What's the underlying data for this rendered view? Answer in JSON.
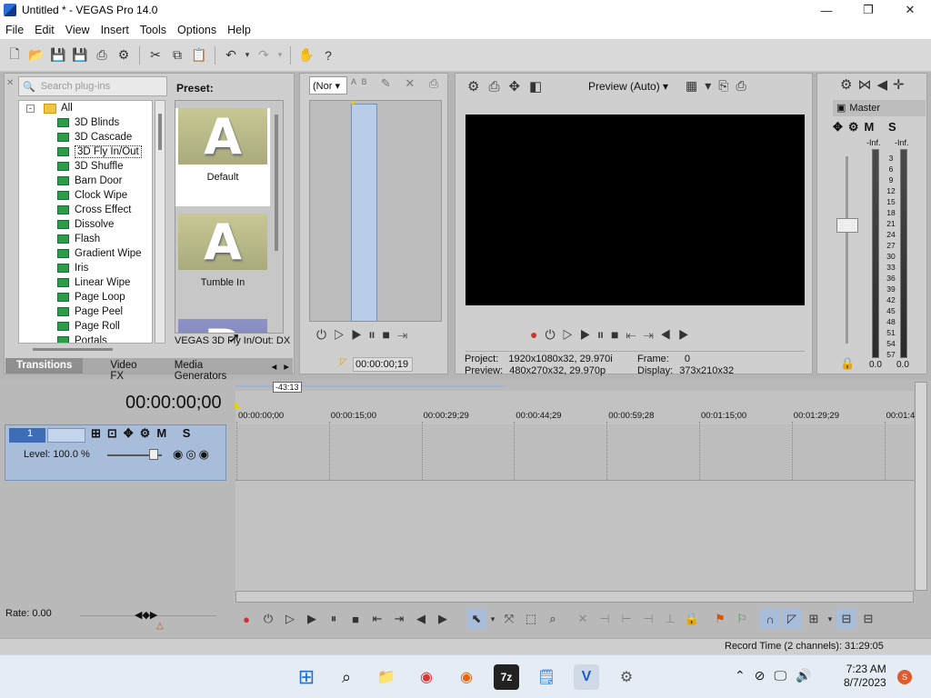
{
  "titlebar": {
    "title": "Untitled * - VEGAS Pro 14.0"
  },
  "menu": [
    "File",
    "Edit",
    "View",
    "Insert",
    "Tools",
    "Options",
    "Help"
  ],
  "plugins": {
    "search_placeholder": "Search plug-ins",
    "root": "All",
    "items": [
      "3D Blinds",
      "3D Cascade",
      "3D Fly In/Out",
      "3D Shuffle",
      "Barn Door",
      "Clock Wipe",
      "Cross Effect",
      "Dissolve",
      "Flash",
      "Gradient Wipe",
      "Iris",
      "Linear Wipe",
      "Page Loop",
      "Page Peel",
      "Page Roll",
      "Portals"
    ],
    "selected_index": 2,
    "preset_label": "Preset:",
    "presets": [
      {
        "glyph": "A",
        "caption": "Default"
      },
      {
        "glyph": "A",
        "caption": "Tumble In"
      },
      {
        "glyph": "B",
        "caption": ""
      }
    ],
    "plugin_name": "VEGAS 3D Fly In/Out: DX",
    "tabs": [
      "Transitions",
      "Video FX",
      "Media Generators"
    ]
  },
  "trimmer": {
    "dropdown": "(Nor",
    "timecode": "00:00:00;19"
  },
  "preview": {
    "quality": "Preview (Auto)",
    "project_label": "Project:",
    "project_value": "1920x1080x32, 29.970i",
    "preview_label": "Preview:",
    "preview_value": "480x270x32, 29.970p",
    "frame_label": "Frame:",
    "frame_value": "0",
    "display_label": "Display:",
    "display_value": "373x210x32"
  },
  "mixer": {
    "title": "Master",
    "inf_left": "-Inf.",
    "inf_right": "-Inf.",
    "scale": [
      "3",
      "6",
      "9",
      "12",
      "15",
      "18",
      "21",
      "24",
      "27",
      "30",
      "33",
      "36",
      "39",
      "42",
      "45",
      "48",
      "51",
      "54",
      "57"
    ],
    "bottom_left": "0.0",
    "bottom_right": "0.0"
  },
  "timeline": {
    "timecode": "00:00:00;00",
    "marker": "-43:13",
    "ruler": [
      "00:00:00;00",
      "00:00:15;00",
      "00:00:29;29",
      "00:00:44;29",
      "00:00:59;28",
      "00:01:15;00",
      "00:01:29;29",
      "00:01:4"
    ],
    "track_number": "1",
    "level_text": "Level: 100.0 %",
    "rate_text": "Rate: 0.00"
  },
  "status": {
    "record_time": "Record Time (2 channels): 31:29:05"
  },
  "clock": {
    "time": "7:23 AM",
    "date": "8/7/2023"
  },
  "colors": {
    "accent": "#2b6fd6",
    "track_blue": "#a7bdd9"
  }
}
